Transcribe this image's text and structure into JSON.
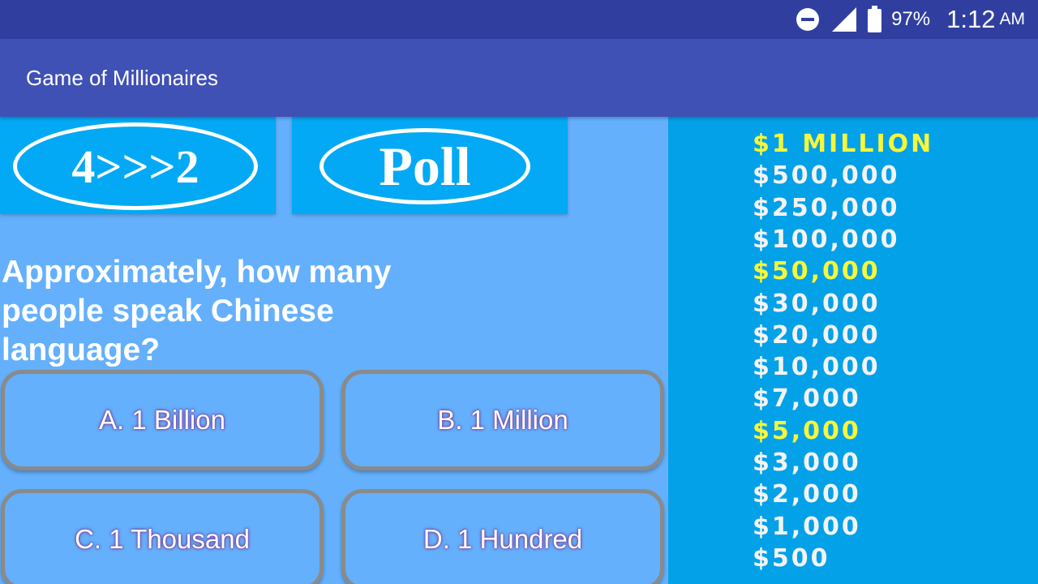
{
  "status_bar": {
    "battery_percent": "97%",
    "time": "1:12",
    "ampm": "AM",
    "icons": [
      "do-not-disturb-icon",
      "signal-icon",
      "battery-icon"
    ]
  },
  "app_bar": {
    "title": "Game of Millionaires"
  },
  "lifelines": {
    "fifty_fifty": "4>>>2",
    "poll": "Poll"
  },
  "question": {
    "text": "Approximately, how many people speak Chinese language?"
  },
  "answers": [
    {
      "label": "A. 1 Billion"
    },
    {
      "label": "B. 1 Million"
    },
    {
      "label": "C. 1 Thousand"
    },
    {
      "label": "D. 1 Hundred"
    }
  ],
  "prize_ladder": [
    {
      "amount": "$1 MILLION",
      "milestone": true
    },
    {
      "amount": "$500,000",
      "milestone": false
    },
    {
      "amount": "$250,000",
      "milestone": false
    },
    {
      "amount": "$100,000",
      "milestone": false
    },
    {
      "amount": "$50,000",
      "milestone": true
    },
    {
      "amount": "$30,000",
      "milestone": false
    },
    {
      "amount": "$20,000",
      "milestone": false
    },
    {
      "amount": "$10,000",
      "milestone": false
    },
    {
      "amount": "$7,000",
      "milestone": false
    },
    {
      "amount": "$5,000",
      "milestone": true
    },
    {
      "amount": "$3,000",
      "milestone": false
    },
    {
      "amount": "$2,000",
      "milestone": false
    },
    {
      "amount": "$1,000",
      "milestone": false
    },
    {
      "amount": "$500",
      "milestone": false
    }
  ],
  "colors": {
    "status_bar": "#303f9f",
    "app_bar": "#3f51b5",
    "lifeline_bg": "#03a9f4",
    "background": "#64b0fc",
    "prize_panel": "#03a1e8",
    "milestone_text": "#f7f73a",
    "answer_border": "#8a8a8a"
  }
}
